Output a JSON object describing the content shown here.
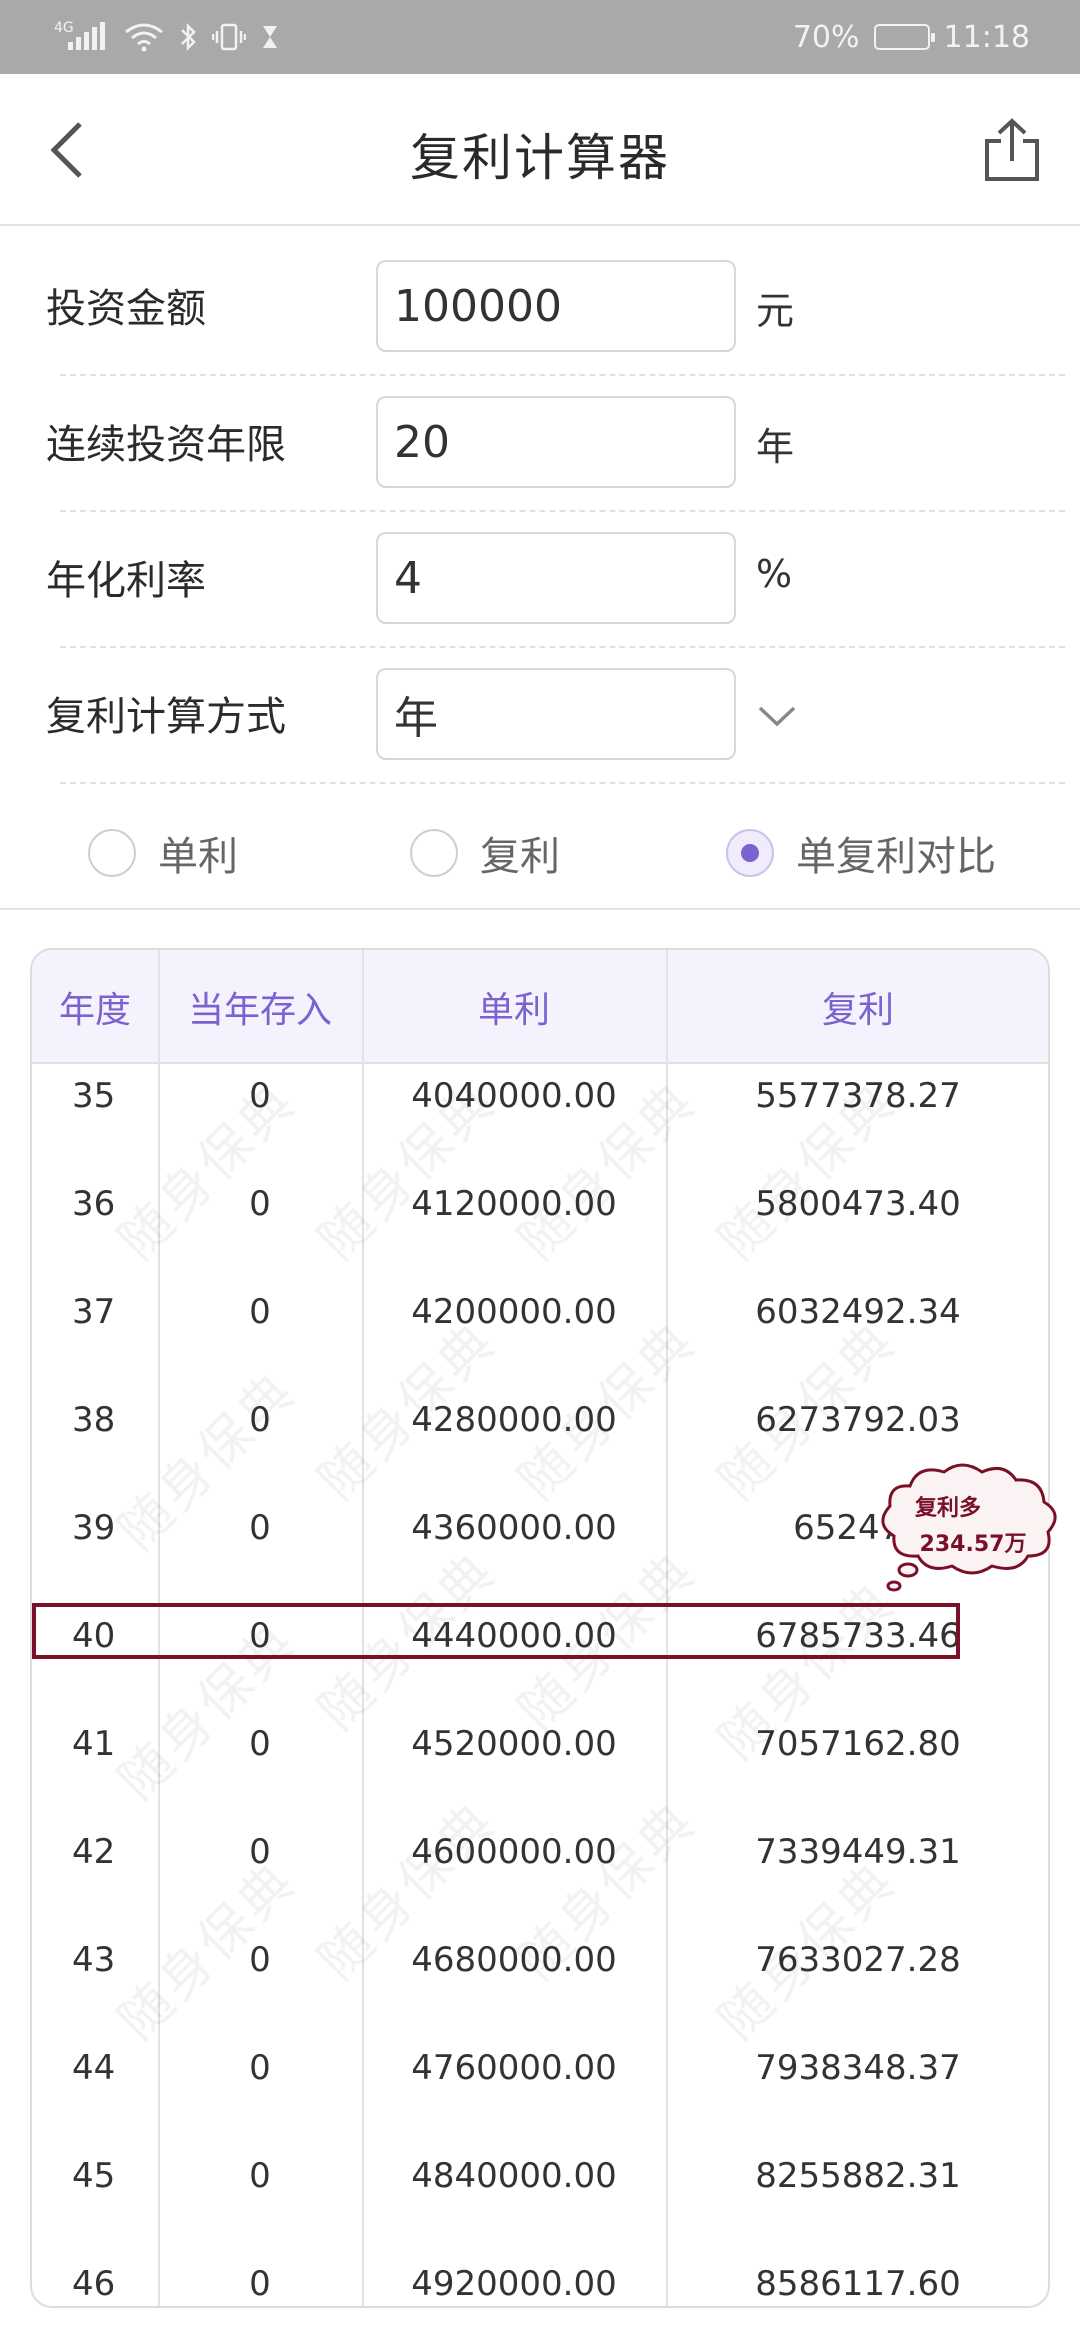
{
  "status_bar": {
    "network": "4G",
    "battery": "70%",
    "battery_level": 0.7,
    "time": "11:18"
  },
  "nav": {
    "title": "复利计算器",
    "back_icon": "chevron-left-icon",
    "share_icon": "share-icon"
  },
  "form": {
    "amount": {
      "label": "投资金额",
      "value": "100000",
      "unit": "元"
    },
    "years": {
      "label": "连续投资年限",
      "value": "20",
      "unit": "年"
    },
    "rate": {
      "label": "年化利率",
      "value": "4",
      "unit": "%"
    },
    "method": {
      "label": "复利计算方式",
      "value": "年"
    }
  },
  "options": [
    {
      "label": "单利",
      "selected": false
    },
    {
      "label": "复利",
      "selected": false
    },
    {
      "label": "单复利对比",
      "selected": true
    }
  ],
  "table": {
    "headers": [
      "年度",
      "当年存入",
      "单利",
      "复利"
    ],
    "rows": [
      [
        "35",
        "0",
        "4040000.00",
        "5577378.27"
      ],
      [
        "36",
        "0",
        "4120000.00",
        "5800473.40"
      ],
      [
        "37",
        "0",
        "4200000.00",
        "6032492.34"
      ],
      [
        "38",
        "0",
        "4280000.00",
        "6273792.03"
      ],
      [
        "39",
        "0",
        "4360000.00",
        "652474"
      ],
      [
        "40",
        "0",
        "4440000.00",
        "6785733.46"
      ],
      [
        "41",
        "0",
        "4520000.00",
        "7057162.80"
      ],
      [
        "42",
        "0",
        "4600000.00",
        "7339449.31"
      ],
      [
        "43",
        "0",
        "4680000.00",
        "7633027.28"
      ],
      [
        "44",
        "0",
        "4760000.00",
        "7938348.37"
      ],
      [
        "45",
        "0",
        "4840000.00",
        "8255882.31"
      ],
      [
        "46",
        "0",
        "4920000.00",
        "8586117.60"
      ]
    ],
    "highlight_year": "40"
  },
  "annotation": {
    "line1": "复利多",
    "line2": "234.57万"
  },
  "watermark": "随身保典",
  "colors": {
    "accent": "#7b62d1",
    "highlight": "#7a1028",
    "status_bar": "#a9a9a9"
  }
}
